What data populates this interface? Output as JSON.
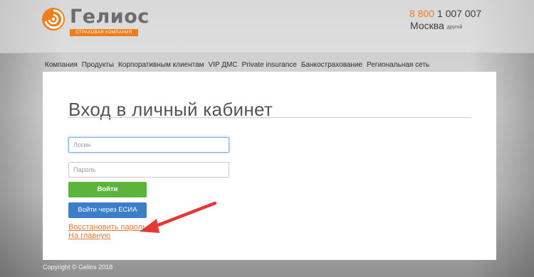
{
  "brand": {
    "name": "Гелиос",
    "tagline": "СТРАХОВАЯ КОМПАНИЯ",
    "accent_color": "#ef7d1b",
    "logo_icon": "orange-spiral-logo-icon"
  },
  "contact": {
    "phone_prefix": "8 800",
    "phone_number": "1 007 007",
    "city": "Москва",
    "other_city": "другой"
  },
  "nav": {
    "items": [
      "Компания",
      "Продукты",
      "Корпоративным клиентам",
      "VIP ДМС",
      "Private insurance",
      "Банкострахование",
      "Региональная сеть"
    ]
  },
  "login": {
    "title": "Вход в личный кабинет",
    "login_placeholder": "Логин",
    "password_placeholder": "Пароль",
    "submit_label": "Войти",
    "esia_label": "Войти через ЕСИА",
    "restore_link": "Восстановить пароль",
    "home_link": "На главную"
  },
  "annotation": {
    "arrow_color": "#e53935",
    "icon": "red-arrow-icon"
  },
  "footer": {
    "copyright": "Copyright © Gelios 2018"
  }
}
